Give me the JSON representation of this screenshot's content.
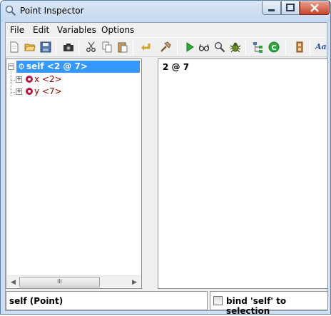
{
  "window": {
    "title": "Point Inspector",
    "icons": {
      "app": "magnifier-icon",
      "minimize": "minimize-icon",
      "maximize": "maximize-icon",
      "close": "close-icon"
    }
  },
  "menu": {
    "file": "File",
    "edit": "Edit",
    "variables": "Variables",
    "options": "Options"
  },
  "toolbar": {
    "icons": [
      "new-document-icon",
      "open-folder-icon",
      "save-disk-icon",
      "camera-icon",
      "cut-scissors-icon",
      "copy-icon",
      "paste-icon",
      "undo-arrow-icon",
      "hammer-icon",
      "run-play-icon",
      "inspect-glasses-icon",
      "find-magnifier-icon",
      "debug-bug-icon",
      "hierarchy-icon",
      "refresh-c-icon",
      "film-strip-icon",
      "font-aa-icon"
    ],
    "font_label": "Aa"
  },
  "tree": {
    "root": {
      "expander": "−",
      "label": "self <2 @ 7>"
    },
    "children": [
      {
        "expander": "+",
        "label": "x <2>"
      },
      {
        "expander": "+",
        "label": "y <7>"
      }
    ]
  },
  "value_pane": {
    "text": "2 @ 7"
  },
  "hscroll": {
    "grip": "III",
    "left_arrow": "◀",
    "right_arrow": "▶"
  },
  "status": {
    "class_text": "self (Point)",
    "bind_label": "bind 'self' to selection",
    "bind_checked": false
  },
  "colors": {
    "selection": "#3399ff",
    "var_icon": "#c0143c",
    "var_name": "#8b0000"
  }
}
